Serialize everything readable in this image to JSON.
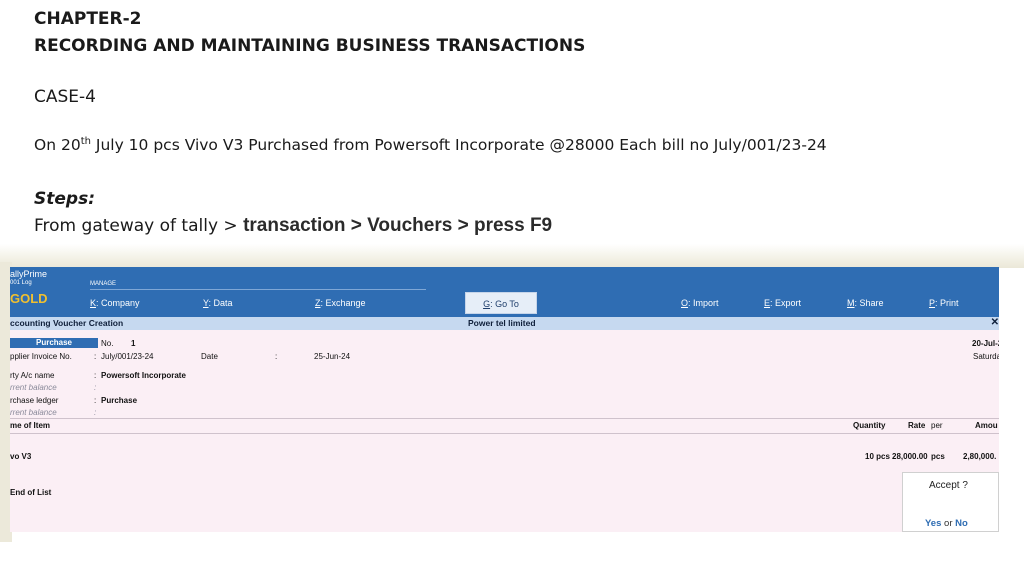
{
  "slide": {
    "chapter": "CHAPTER-2",
    "subtitle": "RECORDING AND MAINTAINING BUSINESS TRANSACTIONS",
    "case": "CASE-4",
    "statement_prefix": "On 20",
    "statement_sup": "th",
    "statement_rest": " July 10 pcs Vivo V3 Purchased from Powersoft Incorporate @28000 Each bill no July/001/23-24",
    "steps_heading": "Steps:",
    "steps_plain": "From gateway of tally > ",
    "steps_nav": "transaction >  Vouchers > press F9"
  },
  "tally": {
    "brand": "allyPrime",
    "brand_edition": "001 Log",
    "brand_gold": "GOLD",
    "manage_label": "MANAGE",
    "menu": [
      {
        "key": "K",
        "label": ": Company"
      },
      {
        "key": "Y",
        "label": ": Data"
      },
      {
        "key": "Z",
        "label": ": Exchange"
      },
      {
        "key": "G",
        "label": ": Go To"
      },
      {
        "key": "O",
        "label": ": Import"
      },
      {
        "key": "E",
        "label": ": Export"
      },
      {
        "key": "M",
        "label": ": Share"
      },
      {
        "key": "P",
        "label": ": Print"
      }
    ],
    "window_title": "ccounting Voucher Creation",
    "company": "Power tel limited",
    "close_glyph": "✕",
    "voucher_type": "Purchase",
    "no_label": "No.",
    "no_value": "1",
    "date_right": "20-Jul-2",
    "day_right": "Saturda",
    "supplier_invoice_label": "pplier Invoice No.",
    "supplier_invoice_value": "July/001/23-24",
    "date_label": "Date",
    "date_value": "25-Jun-24",
    "party_label": "rty A/c name",
    "party_value": "Powersoft Incorporate",
    "current_balance_label": "rrent balance",
    "purchase_ledger_label": "rchase ledger",
    "purchase_ledger_value": "Purchase",
    "col_item": "me of Item",
    "col_quantity": "Quantity",
    "col_rate": "Rate",
    "col_per": "per",
    "col_amount": "Amou",
    "item_name": "vo V3",
    "item_qty": "10 pcs",
    "item_rate": "28,000.00",
    "item_per": "pcs",
    "item_amount": "2,80,000.",
    "end_of_list": "End of List",
    "accept_question": "Accept ?",
    "accept_yes": "Yes",
    "accept_or": "or",
    "accept_no": "No"
  }
}
